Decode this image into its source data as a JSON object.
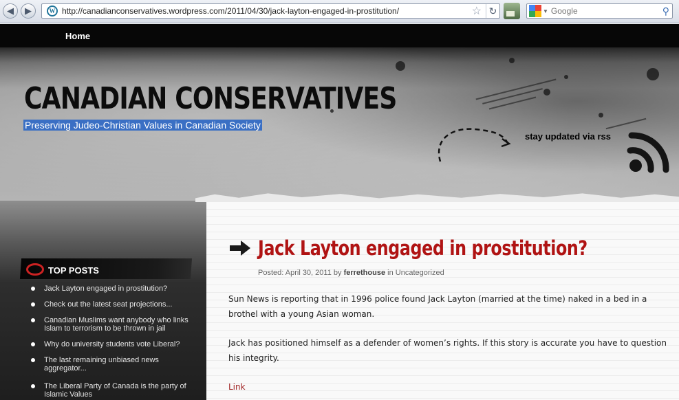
{
  "browser": {
    "url": "http://canadianconservatives.wordpress.com/2011/04/30/jack-layton-engaged-in-prostitution/",
    "favicon_letter": "W",
    "search_placeholder": "Google",
    "icons": [
      "back-arrow-icon",
      "forward-arrow-icon",
      "wordpress-favicon-icon",
      "bookmark-star-icon",
      "reload-icon",
      "google-logo-icon",
      "magnifier-icon"
    ]
  },
  "nav": {
    "home": "Home"
  },
  "header": {
    "title": "CANADIAN CONSERVATIVES",
    "tagline": "Preserving Judeo-Christian Values in Canadian Society",
    "rss_label": "stay updated via rss"
  },
  "sidebar": {
    "widget_title": "TOP POSTS",
    "posts": [
      "Jack Layton engaged in prostitution?",
      "Check out the latest seat projections...",
      "Canadian Muslims want anybody who links Islam to terrorism to be thrown in jail",
      "Why do university students vote Liberal?",
      "The last remaining unbiased news aggregator...",
      "The Liberal Party of Canada is the party of Islamic Values"
    ]
  },
  "post": {
    "title": "Jack Layton engaged in prostitution?",
    "meta_prefix": "Posted: April 30, 2011 by",
    "author": "ferrethouse",
    "meta_in": "in",
    "category": "Uncategorized",
    "paragraphs": [
      "Sun News is reporting that in 1996 police found Jack Layton (married at the time) naked in a bed in a brothel with a young Asian woman.",
      "Jack has positioned himself as a defender of women’s rights. If this story is accurate you have to question his integrity."
    ],
    "link_text": "Link"
  },
  "colors": {
    "title_red": "#b01313",
    "tagline_bg": "#3a6fc4",
    "topbar": "#070707"
  }
}
